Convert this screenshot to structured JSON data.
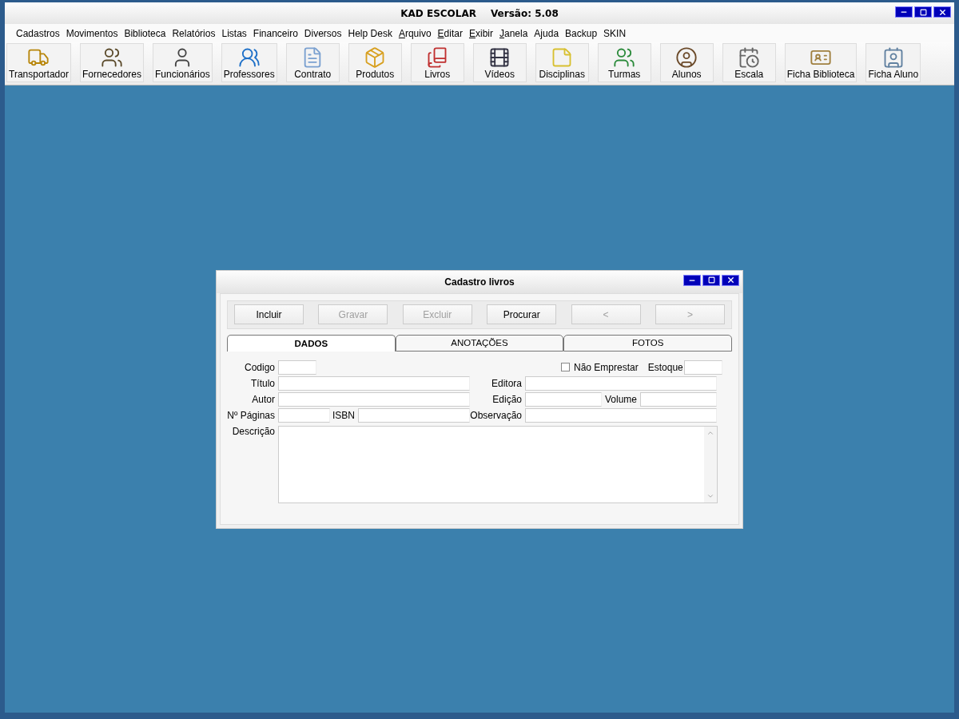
{
  "window": {
    "title": "KAD ESCOLAR",
    "version": "Versão: 5.08"
  },
  "menu": [
    {
      "label": "Cadastros",
      "underlined": false
    },
    {
      "label": "Movimentos",
      "underlined": false
    },
    {
      "label": "Biblioteca",
      "underlined": false
    },
    {
      "label": "Relatórios",
      "underlined": false
    },
    {
      "label": "Listas",
      "underlined": false
    },
    {
      "label": "Financeiro",
      "underlined": false
    },
    {
      "label": "Diversos",
      "underlined": false
    },
    {
      "label": "Help Desk",
      "underlined": false
    },
    {
      "label": "Arquivo",
      "underlined": true
    },
    {
      "label": "Editar",
      "underlined": true
    },
    {
      "label": "Exibir",
      "underlined": true
    },
    {
      "label": "Janela",
      "underlined": true
    },
    {
      "label": "Ajuda",
      "underlined": false
    },
    {
      "label": "Backup",
      "underlined": false
    },
    {
      "label": "SKIN",
      "underlined": false
    }
  ],
  "toolbar": [
    {
      "label": "Transportador"
    },
    {
      "label": "Fornecedores"
    },
    {
      "label": "Funcionários"
    },
    {
      "label": "Professores"
    },
    {
      "label": "Contrato"
    },
    {
      "label": "Produtos"
    },
    {
      "label": "Livros"
    },
    {
      "label": "Vídeos"
    },
    {
      "label": "Disciplinas"
    },
    {
      "label": "Turmas"
    },
    {
      "label": "Alunos"
    },
    {
      "label": "Escala"
    },
    {
      "label": "Ficha Biblioteca"
    },
    {
      "label": "Ficha Aluno"
    }
  ],
  "dialog": {
    "title": "Cadastro livros",
    "buttons": [
      {
        "label": "Incluir",
        "disabled": false
      },
      {
        "label": "Gravar",
        "disabled": true
      },
      {
        "label": "Excluir",
        "disabled": true
      },
      {
        "label": "Procurar",
        "disabled": false
      },
      {
        "label": "<",
        "disabled": true
      },
      {
        "label": ">",
        "disabled": true
      }
    ],
    "tabs": [
      {
        "label": "DADOS",
        "selected": true
      },
      {
        "label": "ANOTAÇÕES",
        "selected": false
      },
      {
        "label": "FOTOS",
        "selected": false
      }
    ],
    "form": {
      "codigo": {
        "label": "Codigo"
      },
      "nao_emprestar": {
        "label": "Não Emprestar",
        "checked": false
      },
      "estoque": {
        "label": "Estoque"
      },
      "titulo": {
        "label": "Título"
      },
      "editora": {
        "label": "Editora"
      },
      "autor": {
        "label": "Autor"
      },
      "edicao": {
        "label": "Edição"
      },
      "volume": {
        "label": "Volume"
      },
      "paginas": {
        "label": "Nº Páginas"
      },
      "isbn": {
        "label": "ISBN"
      },
      "observacao": {
        "label": "Observação"
      },
      "descricao": {
        "label": "Descrição"
      }
    }
  }
}
